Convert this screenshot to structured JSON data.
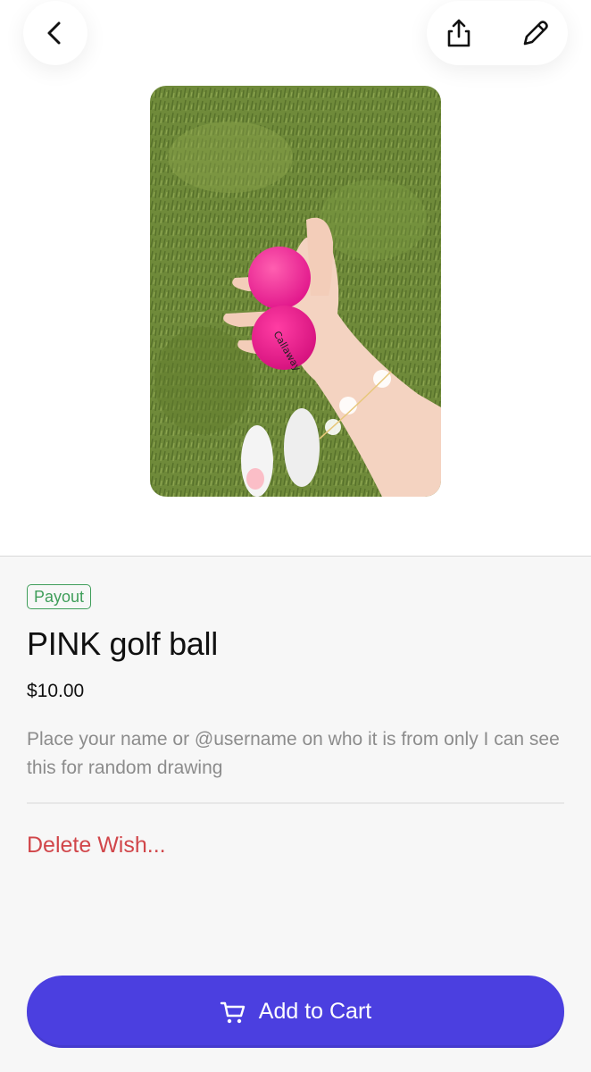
{
  "header": {
    "back_icon": "chevron-left-icon",
    "share_icon": "share-icon",
    "edit_icon": "pencil-icon"
  },
  "item": {
    "badge": "Payout",
    "title": "PINK golf ball",
    "price": "$10.00",
    "description": "Place your name or @username on who it is from only I can see this for random drawing",
    "delete_label": "Delete Wish...",
    "photo_alt": "Hand holding two pink Callaway golf balls over grass"
  },
  "footer": {
    "add_to_cart_label": "Add to Cart",
    "cart_icon": "cart-icon"
  },
  "colors": {
    "accent": "#4b3fe0",
    "badge_green": "#3f9e5a",
    "delete_red": "#d1464a",
    "muted_text": "#8c8c8c"
  }
}
